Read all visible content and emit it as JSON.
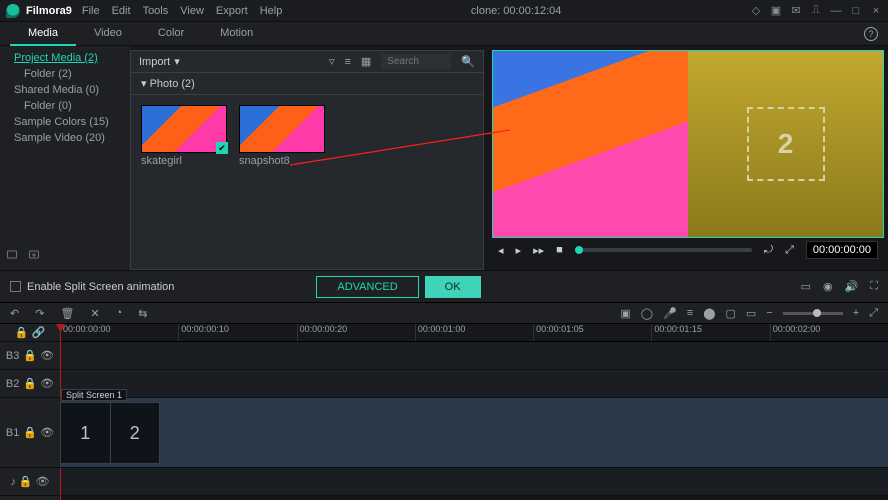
{
  "app": {
    "name": "Filmora9",
    "title": "clone: 00:00:12:04"
  },
  "menu": {
    "file": "File",
    "edit": "Edit",
    "tools": "Tools",
    "view": "View",
    "export": "Export",
    "help": "Help"
  },
  "tabs": {
    "media": "Media",
    "video": "Video",
    "color": "Color",
    "motion": "Motion"
  },
  "tree": {
    "project": "Project Media (2)",
    "folder2": "Folder (2)",
    "shared": "Shared Media (0)",
    "folder0": "Folder (0)",
    "colors": "Sample Colors (15)",
    "videos": "Sample Video (20)"
  },
  "media": {
    "import": "Import",
    "search_placeholder": "Search",
    "folder": "Photo (2)",
    "thumbs": [
      {
        "name": "skategirl",
        "checked": true
      },
      {
        "name": "snapshot8",
        "checked": false
      }
    ]
  },
  "preview": {
    "dropzone": "2",
    "timecode": "00:00:00:00"
  },
  "actionbar": {
    "enable_split": "Enable Split Screen animation",
    "advanced": "ADVANCED",
    "ok": "OK"
  },
  "ruler": [
    "00:00:00:00",
    "00:00:00:10",
    "00:00:00:20",
    "00:00:01:00",
    "00:00:01:05",
    "00:00:01:15",
    "00:00:02:00"
  ],
  "tracks": {
    "b3": "B3",
    "b2": "B2",
    "b1": "B1"
  },
  "clip": {
    "title": "Split Screen 1",
    "c1": "1",
    "c2": "2"
  }
}
